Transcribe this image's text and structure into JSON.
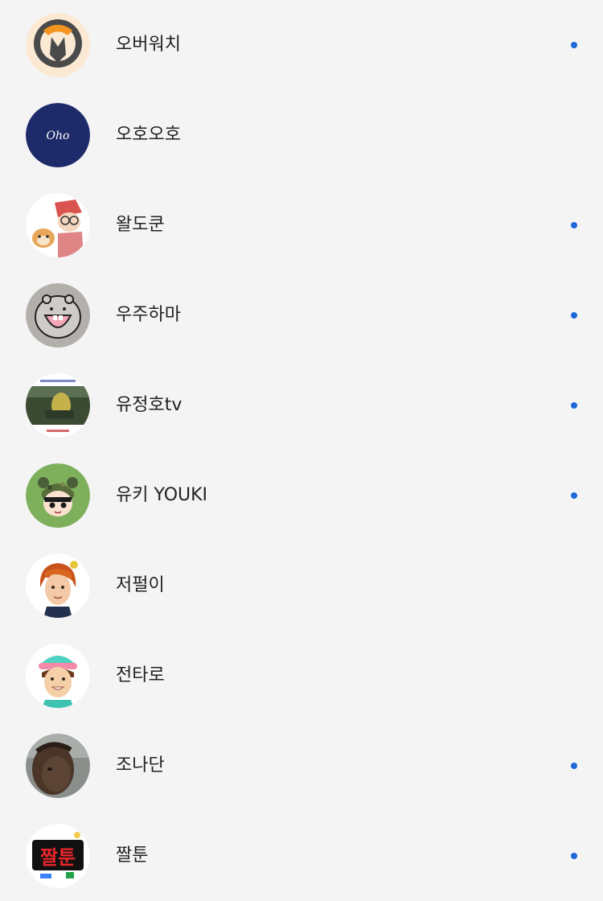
{
  "accent_color": "#1f67d6",
  "channels": [
    {
      "name": "오버워치",
      "avatar_icon": "overwatch-logo-icon",
      "has_new": true
    },
    {
      "name": "오호오호",
      "avatar_icon": "oho-logo-icon",
      "avatar_text": "Oho",
      "has_new": false
    },
    {
      "name": "왈도쿤",
      "avatar_icon": "waldokun-character-icon",
      "has_new": true
    },
    {
      "name": "우주하마",
      "avatar_icon": "hippo-face-icon",
      "has_new": true
    },
    {
      "name": "유정호tv",
      "avatar_icon": "game-scene-icon",
      "has_new": true
    },
    {
      "name": "유키 YOUKI",
      "avatar_icon": "youki-character-icon",
      "has_new": true
    },
    {
      "name": "저펄이",
      "avatar_icon": "orange-hair-character-icon",
      "has_new": false
    },
    {
      "name": "전타로",
      "avatar_icon": "mint-hat-character-icon",
      "has_new": false
    },
    {
      "name": "조나단",
      "avatar_icon": "person-photo-icon",
      "has_new": true
    },
    {
      "name": "짤툰",
      "avatar_icon": "jjaltoon-logo-icon",
      "avatar_text": "짤툰",
      "has_new": true
    }
  ]
}
